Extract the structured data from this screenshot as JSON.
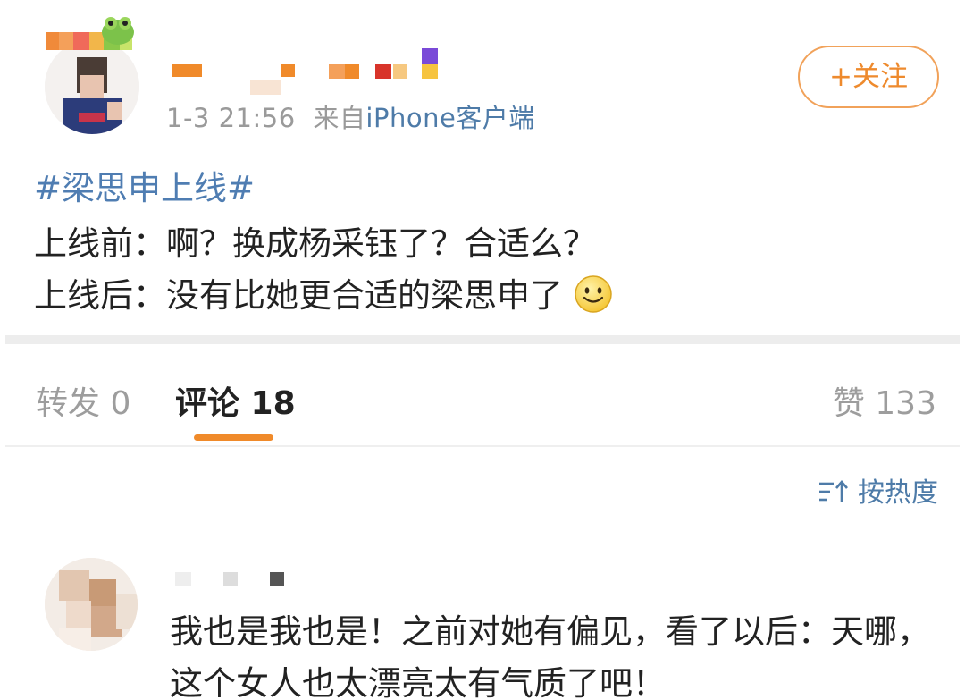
{
  "post": {
    "meta_time": "1-3 21:56",
    "meta_source_prefix": "来自",
    "meta_source_device": "iPhone客户端",
    "follow_label": "+关注",
    "topic": "#梁思申上线#",
    "line1": "上线前：啊？换成杨采钰了？合适么？",
    "line2": "上线后：没有比她更合适的梁思申了",
    "line2_emoji": "smiley-face-icon"
  },
  "tabs": {
    "repost": "转发 0",
    "comment": "评论 18",
    "like": "赞 133"
  },
  "sort": {
    "label": "按热度",
    "icon": "sort-icon"
  },
  "comment": {
    "text": "我也是我也是！之前对她有偏见，看了以后：天哪，这个女人也太漂亮太有气质了吧！"
  },
  "colors": {
    "accent_orange": "#f08a2a",
    "link_blue": "#4f7db2",
    "muted_gray": "#9d9d9d"
  }
}
